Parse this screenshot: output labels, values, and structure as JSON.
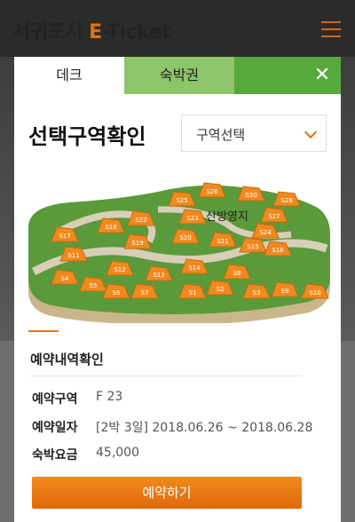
{
  "header": {
    "brand_kr": "서귀포시",
    "brand_e": "E",
    "brand_rest": "-Ticket"
  },
  "modal": {
    "tabs": [
      {
        "label": "데크"
      },
      {
        "label": "숙박권"
      }
    ],
    "close_label": "✕",
    "title": "선택구역확인",
    "select": {
      "value": "구역선택"
    }
  },
  "map": {
    "area_label": "산방영지",
    "sites": [
      "S1",
      "S2",
      "S3",
      "S4",
      "S5",
      "S6",
      "S7",
      "S8",
      "S9",
      "S10",
      "S11",
      "S12",
      "S13",
      "S14",
      "S15",
      "S16",
      "S17",
      "S18",
      "S19",
      "S20",
      "S21",
      "S22",
      "S23",
      "S24",
      "S25",
      "S26",
      "S27",
      "S28",
      "S30"
    ]
  },
  "reservation": {
    "title": "예약내역확인",
    "rows": [
      {
        "key": "예약구역",
        "value": "F 23"
      },
      {
        "key": "예약일자",
        "value": "[2박 3일] 2018.06.26 ~ 2018.06.28"
      },
      {
        "key": "숙박요금",
        "value": "45,000"
      }
    ],
    "button_label": "예약하기"
  },
  "colors": {
    "accent": "#e07010",
    "tab_active_bg": "#ffffff",
    "tab_bg": "#8cc56a",
    "tab_bar": "#57a93d",
    "button": "#e87c14"
  }
}
